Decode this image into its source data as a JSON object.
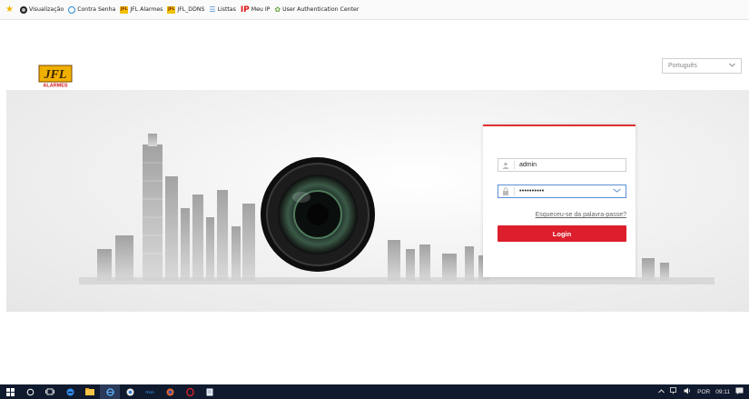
{
  "bookmarks": [
    {
      "icon": "star-icon",
      "label": ""
    },
    {
      "icon": "eye-icon",
      "label": "Visualização"
    },
    {
      "icon": "ie-icon",
      "label": "Contra Senha"
    },
    {
      "icon": "jfl-icon",
      "label": "JFL Alarmes"
    },
    {
      "icon": "jfl-icon",
      "label": "JFL_DDNS"
    },
    {
      "icon": "list-icon",
      "label": "Listtas"
    },
    {
      "icon": "ip-icon",
      "label": "Meu IP"
    },
    {
      "icon": "uac-icon",
      "label": "User Authentication Center"
    }
  ],
  "logo": {
    "text": "JFL",
    "subtext": "ALARMES",
    "color": "#b8860b"
  },
  "language": {
    "selected": "Português"
  },
  "login": {
    "username_value": "admin",
    "password_value": "••••••••••",
    "forgot_label": "Esqueceu-se da palavra-passe?",
    "login_label": "Login"
  },
  "taskbar": {
    "items": [
      "windows-start-icon",
      "search-icon",
      "task-view-icon",
      "edge-icon",
      "file-explorer-icon",
      "internet-explorer-icon",
      "chrome-icon",
      "msn-icon",
      "firefox-icon",
      "opera-icon",
      "notepad-icon"
    ],
    "lang": "POR",
    "time": "09:11"
  },
  "colors": {
    "accent": "#dd1e2c",
    "taskbar": "#101a2e"
  }
}
